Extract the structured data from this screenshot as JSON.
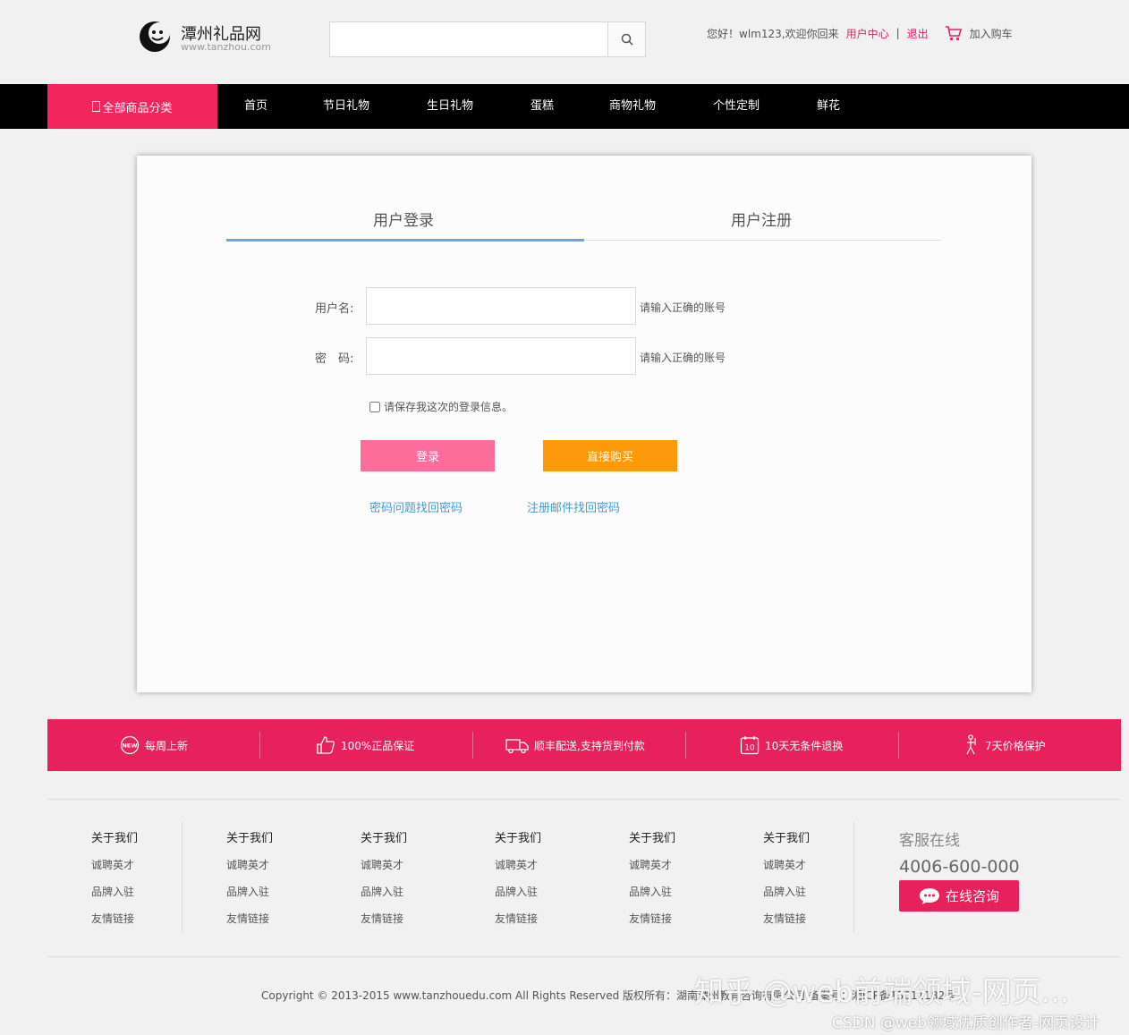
{
  "header": {
    "logo_title": "潭州礼品网",
    "logo_url": "www.tanzhou.com",
    "search_value": "",
    "greeting": "您好！wlm123,欢迎你回来",
    "user_center": "用户中心",
    "separator": "|",
    "logout": "退出",
    "cart": "加入购车"
  },
  "nav": {
    "all_categories": "全部商品分类",
    "items": [
      "首页",
      "节日礼物",
      "生日礼物",
      "蛋糕",
      "商物礼物",
      "个性定制",
      "鲜花"
    ]
  },
  "login": {
    "tab_login": "用户登录",
    "tab_register": "用户注册",
    "username_label": "用户名:",
    "username_value": "",
    "username_hint": "请输入正确的账号",
    "password_label": "密　码:",
    "password_value": "",
    "password_hint": "请输入正确的账号",
    "remember_label": "请保存我这次的登录信息。",
    "remember_checked": false,
    "login_button": "登录",
    "buy_button": "直接购买",
    "link_question": "密码问题找回密码",
    "link_email": "注册邮件找回密码"
  },
  "features": [
    {
      "icon": "new-badge-icon",
      "label": "每周上新"
    },
    {
      "icon": "thumbs-up-icon",
      "label": "100%正品保证"
    },
    {
      "icon": "delivery-truck-icon",
      "label": "顺丰配送,支持货到付款"
    },
    {
      "icon": "calendar-10-icon",
      "label": "10天无条件退换"
    },
    {
      "icon": "price-guard-icon",
      "label": "7天价格保护"
    }
  ],
  "footer": {
    "columns": [
      {
        "title": "关于我们",
        "items": [
          "诚聘英才",
          "品牌入驻",
          "友情链接"
        ]
      },
      {
        "title": "关于我们",
        "items": [
          "诚聘英才",
          "品牌入驻",
          "友情链接"
        ]
      },
      {
        "title": "关于我们",
        "items": [
          "诚聘英才",
          "品牌入驻",
          "友情链接"
        ]
      },
      {
        "title": "关于我们",
        "items": [
          "诚聘英才",
          "品牌入驻",
          "友情链接"
        ]
      },
      {
        "title": "关于我们",
        "items": [
          "诚聘英才",
          "品牌入驻",
          "友情链接"
        ]
      },
      {
        "title": "关于我们",
        "items": [
          "诚聘英才",
          "品牌入驻",
          "友情链接"
        ]
      }
    ],
    "service_title": "客服在线",
    "service_phone": "4006-600-000",
    "service_button": "在线咨询",
    "copyright": "Copyright © 2013-2015 www.tanzhouedu.com All Rights Reserved 版权所有：湖南潭州教育咨询有限公司 备案号：湘ICP备13011182号"
  },
  "watermarks": {
    "zhihu": "知乎 @web前端领域-网页...",
    "csdn": "CSDN @web领域优质创作者-网页设计"
  },
  "colors": {
    "brand_pink": "#e6215c",
    "nav_pink": "#f2255c",
    "login_button": "#fc6d9b",
    "buy_button": "#fc9a0b",
    "link_blue": "#4a9ad0",
    "tab_active": "#6aa7d6"
  }
}
